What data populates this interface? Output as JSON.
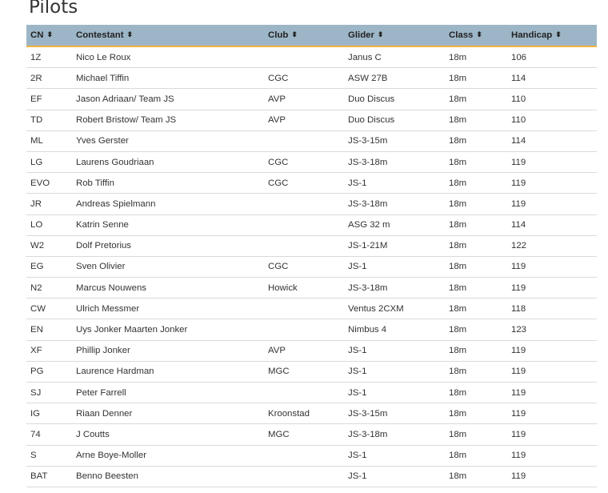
{
  "page_title": "Pilots",
  "columns": {
    "cn": "CN",
    "contestant": "Contestant",
    "club": "Club",
    "glider": "Glider",
    "class": "Class",
    "handicap": "Handicap"
  },
  "sort_icon": "⬍",
  "colors": {
    "header_bg": "#9db6c7",
    "header_border": "#f2b33d",
    "row_border": "#dadada"
  },
  "rows": [
    {
      "cn": "1Z",
      "contestant": "Nico Le Roux",
      "club": "",
      "glider": "Janus C",
      "class": "18m",
      "handicap": "106"
    },
    {
      "cn": "2R",
      "contestant": "Michael Tiffin",
      "club": "CGC",
      "glider": "ASW 27B",
      "class": "18m",
      "handicap": "114"
    },
    {
      "cn": "EF",
      "contestant": "Jason Adriaan/ Team JS",
      "club": "AVP",
      "glider": "Duo Discus",
      "class": "18m",
      "handicap": "110"
    },
    {
      "cn": "TD",
      "contestant": "Robert Bristow/ Team JS",
      "club": "AVP",
      "glider": "Duo Discus",
      "class": "18m",
      "handicap": "110"
    },
    {
      "cn": "ML",
      "contestant": "Yves Gerster",
      "club": "",
      "glider": "JS-3-15m",
      "class": "18m",
      "handicap": "114"
    },
    {
      "cn": "LG",
      "contestant": "Laurens Goudriaan",
      "club": "CGC",
      "glider": "JS-3-18m",
      "class": "18m",
      "handicap": "119"
    },
    {
      "cn": "EVO",
      "contestant": "Rob Tiffin",
      "club": "CGC",
      "glider": "JS-1",
      "class": "18m",
      "handicap": "119"
    },
    {
      "cn": "JR",
      "contestant": "Andreas Spielmann",
      "club": "",
      "glider": "JS-3-18m",
      "class": "18m",
      "handicap": "119"
    },
    {
      "cn": "LO",
      "contestant": "Katrin Senne",
      "club": "",
      "glider": "ASG 32 m",
      "class": "18m",
      "handicap": "114"
    },
    {
      "cn": "W2",
      "contestant": "Dolf Pretorius",
      "club": "",
      "glider": "JS-1-21M",
      "class": "18m",
      "handicap": "122"
    },
    {
      "cn": "EG",
      "contestant": "Sven Olivier",
      "club": "CGC",
      "glider": "JS-1",
      "class": "18m",
      "handicap": "119"
    },
    {
      "cn": "N2",
      "contestant": "Marcus Nouwens",
      "club": "Howick",
      "glider": "JS-3-18m",
      "class": "18m",
      "handicap": "119"
    },
    {
      "cn": "CW",
      "contestant": "Ulrich Messmer",
      "club": "",
      "glider": "Ventus 2CXM",
      "class": "18m",
      "handicap": "118"
    },
    {
      "cn": "EN",
      "contestant": "Uys Jonker Maarten Jonker",
      "club": "",
      "glider": "Nimbus 4",
      "class": "18m",
      "handicap": "123"
    },
    {
      "cn": "XF",
      "contestant": "Phillip Jonker",
      "club": "AVP",
      "glider": "JS-1",
      "class": "18m",
      "handicap": "119"
    },
    {
      "cn": "PG",
      "contestant": "Laurence Hardman",
      "club": "MGC",
      "glider": "JS-1",
      "class": "18m",
      "handicap": "119"
    },
    {
      "cn": "SJ",
      "contestant": "Peter Farrell",
      "club": "",
      "glider": "JS-1",
      "class": "18m",
      "handicap": "119"
    },
    {
      "cn": "IG",
      "contestant": "Riaan Denner",
      "club": "Kroonstad",
      "glider": "JS-3-15m",
      "class": "18m",
      "handicap": "119"
    },
    {
      "cn": "74",
      "contestant": "J Coutts",
      "club": "MGC",
      "glider": "JS-3-18m",
      "class": "18m",
      "handicap": "119"
    },
    {
      "cn": "S",
      "contestant": "Arne Boye-Moller",
      "club": "",
      "glider": "JS-1",
      "class": "18m",
      "handicap": "119"
    },
    {
      "cn": "BAT",
      "contestant": "Benno Beesten",
      "club": "",
      "glider": "JS-1",
      "class": "18m",
      "handicap": "119"
    }
  ]
}
